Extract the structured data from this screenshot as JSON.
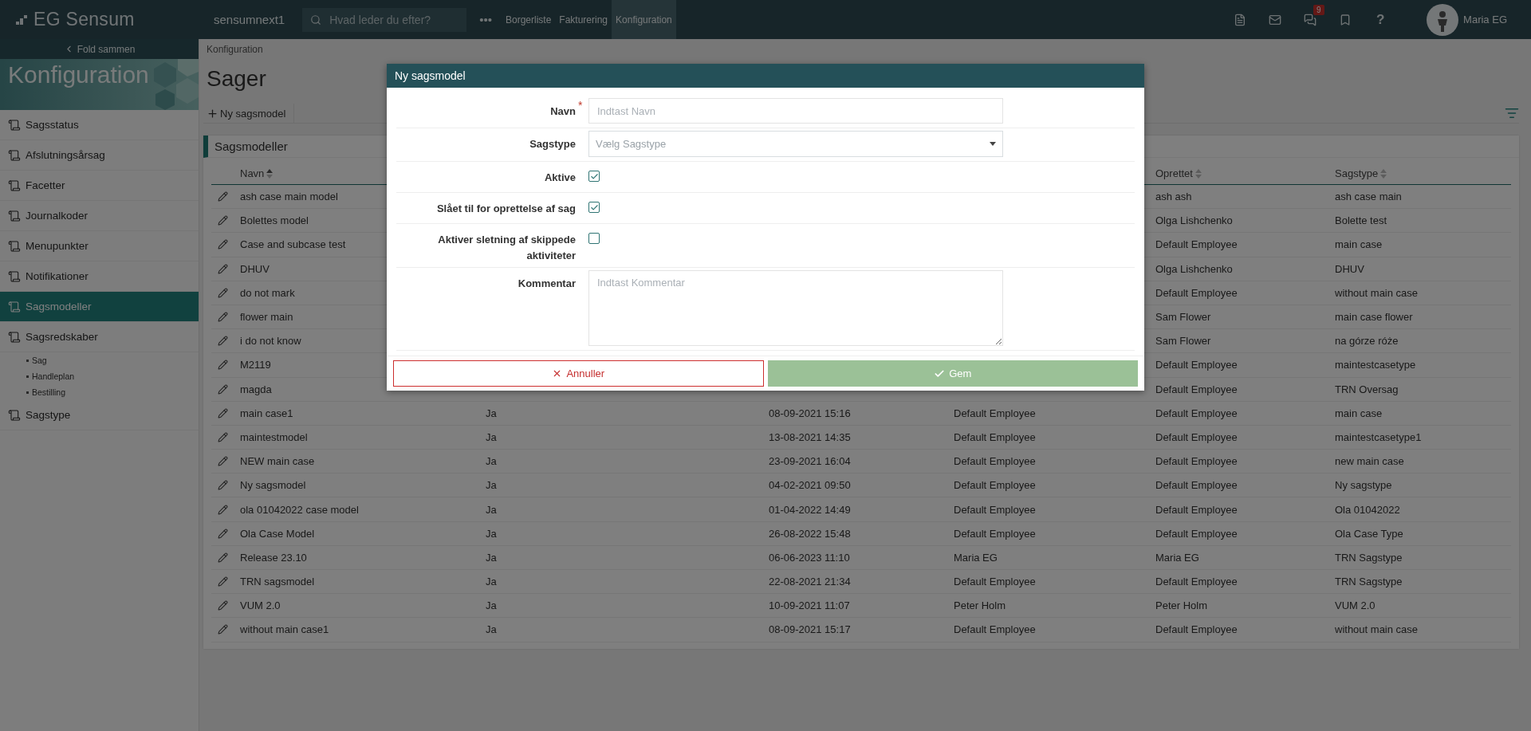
{
  "topbar": {
    "logo": "EG Sensum",
    "environment": "sensumnext1",
    "search": {
      "placeholder": "Hvad leder du efter?"
    },
    "more": "•••",
    "nav": [
      {
        "label": "Borgerliste",
        "selected": false
      },
      {
        "label": "Fakturering",
        "selected": false
      },
      {
        "label": "Konfiguration",
        "selected": true
      }
    ],
    "notification_badge": "9",
    "help": "?",
    "user": "Maria EG"
  },
  "sidebar": {
    "collapse": "Fold sammen",
    "banner_title": "Konfiguration",
    "items": [
      {
        "label": "Sagsstatus",
        "selected": false
      },
      {
        "label": "Afslutningsårsag",
        "selected": false
      },
      {
        "label": "Facetter",
        "selected": false
      },
      {
        "label": "Journalkoder",
        "selected": false
      },
      {
        "label": "Menupunkter",
        "selected": false
      },
      {
        "label": "Notifikationer",
        "selected": false
      },
      {
        "label": "Sagsmodeller",
        "selected": true
      },
      {
        "label": "Sagsredskaber",
        "selected": false,
        "children": [
          {
            "label": "Sag"
          },
          {
            "label": "Handleplan"
          },
          {
            "label": "Bestilling"
          }
        ]
      },
      {
        "label": "Sagstype",
        "selected": false
      }
    ]
  },
  "breadcrumb": "Konfiguration",
  "page_title": "Sager",
  "toolbar": {
    "new_button": "Ny sagsmodel"
  },
  "panel": {
    "title": "Sagsmodeller",
    "columns": [
      {
        "label": "Navn",
        "sorted": true
      },
      {},
      {},
      {},
      {
        "label": "Oprettet",
        "sorted": false
      },
      {
        "label": "Sagstype",
        "sorted": false
      }
    ],
    "rows": [
      {
        "cells": [
          "ash case main model",
          null,
          null,
          null,
          "ash ash",
          "ash case main"
        ]
      },
      {
        "cells": [
          "Bolettes model",
          null,
          null,
          null,
          "Olga Lishchenko",
          "Bolette test"
        ]
      },
      {
        "cells": [
          "Case and subcase test",
          null,
          null,
          null,
          "Default Employee",
          "main case"
        ]
      },
      {
        "cells": [
          "DHUV",
          null,
          null,
          null,
          "Olga Lishchenko",
          "DHUV"
        ]
      },
      {
        "cells": [
          "do not mark",
          null,
          null,
          null,
          "Default Employee",
          "without main case"
        ]
      },
      {
        "cells": [
          "flower main",
          null,
          null,
          null,
          "Sam Flower",
          "main case flower"
        ]
      },
      {
        "cells": [
          "i do not know",
          null,
          null,
          null,
          "Sam Flower",
          "na górze róże"
        ]
      },
      {
        "cells": [
          "M2119",
          null,
          null,
          null,
          "Default Employee",
          "maintestcasetype"
        ]
      },
      {
        "cells": [
          "magda",
          null,
          null,
          null,
          "Default Employee",
          "TRN Oversag"
        ]
      },
      {
        "cells": [
          "main case1",
          "Ja",
          "08-09-2021 15:16",
          "Default Employee",
          "Default Employee",
          "main case"
        ]
      },
      {
        "cells": [
          "maintestmodel",
          "Ja",
          "13-08-2021 14:35",
          "Default Employee",
          "Default Employee",
          "maintestcasetype1"
        ]
      },
      {
        "cells": [
          "NEW main case",
          "Ja",
          "23-09-2021 16:04",
          "Default Employee",
          "Default Employee",
          "new main case"
        ]
      },
      {
        "cells": [
          "Ny sagsmodel",
          "Ja",
          "04-02-2021 09:50",
          "Default Employee",
          "Default Employee",
          "Ny sagstype"
        ]
      },
      {
        "cells": [
          "ola 01042022 case model",
          "Ja",
          "01-04-2022 14:49",
          "Default Employee",
          "Default Employee",
          "Ola 01042022"
        ]
      },
      {
        "cells": [
          "Ola Case Model",
          "Ja",
          "26-08-2022 15:48",
          "Default Employee",
          "Default Employee",
          "Ola Case Type"
        ]
      },
      {
        "cells": [
          "Release 23.10",
          "Ja",
          "06-06-2023 11:10",
          "Maria EG",
          "Maria EG",
          "TRN Sagstype"
        ]
      },
      {
        "cells": [
          "TRN sagsmodel",
          "Ja",
          "22-08-2021 21:34",
          "Default Employee",
          "Default Employee",
          "TRN Sagstype"
        ]
      },
      {
        "cells": [
          "VUM 2.0",
          "Ja",
          "10-09-2021 11:07",
          "Peter Holm",
          "Peter Holm",
          "VUM 2.0"
        ]
      },
      {
        "cells": [
          "without main case1",
          "Ja",
          "08-09-2021 15:17",
          "Default Employee",
          "Default Employee",
          "without main case"
        ]
      }
    ]
  },
  "modal": {
    "title": "Ny sagsmodel",
    "required_marker": "*",
    "fields": [
      {
        "kind": "text",
        "label": "Navn",
        "required": true,
        "placeholder": "Indtast Navn"
      },
      {
        "kind": "select",
        "label": "Sagstype",
        "required": false,
        "placeholder": "Vælg Sagstype"
      },
      {
        "kind": "checkbox",
        "label": "Aktive",
        "required": false,
        "checked": true
      },
      {
        "kind": "checkbox",
        "label": "Slået til for oprettelse af sag",
        "required": false,
        "checked": true
      },
      {
        "kind": "checkbox",
        "label": "Aktiver sletning af skippede aktiviteter",
        "required": false,
        "checked": false
      },
      {
        "kind": "textarea",
        "label": "Kommentar",
        "required": false,
        "placeholder": "Indtast Kommentar"
      }
    ],
    "buttons": [
      {
        "kind": "cancel",
        "label": "Annuller"
      },
      {
        "kind": "save",
        "label": "Gem"
      }
    ]
  }
}
